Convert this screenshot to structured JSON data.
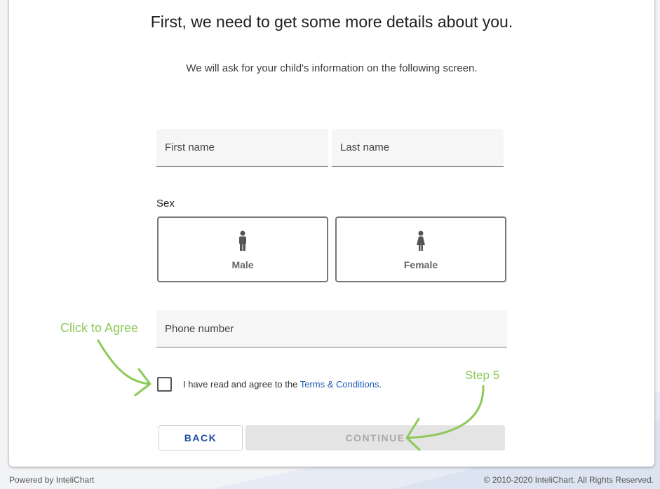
{
  "heading": "First, we need to get some more details about you.",
  "subheading": "We will ask for your child's information on the following screen.",
  "fields": {
    "first_name": "First name",
    "last_name": "Last name",
    "phone": "Phone number"
  },
  "sex": {
    "label": "Sex",
    "options": [
      "Male",
      "Female"
    ]
  },
  "agreement": {
    "prefix": "I have read and agree to the ",
    "link": "Terms & Conditions",
    "suffix": "."
  },
  "buttons": {
    "back": "BACK",
    "continue": "CONTINUE"
  },
  "annotations": {
    "agree": "Click to Agree",
    "step": "Step 5"
  },
  "footer": {
    "left": "Powered by InteliChart",
    "right": "© 2010-2020 InteliChart. All Rights Reserved."
  },
  "colors": {
    "annotation": "#8dc95a",
    "link": "#1d5bb6"
  },
  "icons": [
    "male-person-icon",
    "female-person-icon",
    "annotation-arrow-icon"
  ]
}
